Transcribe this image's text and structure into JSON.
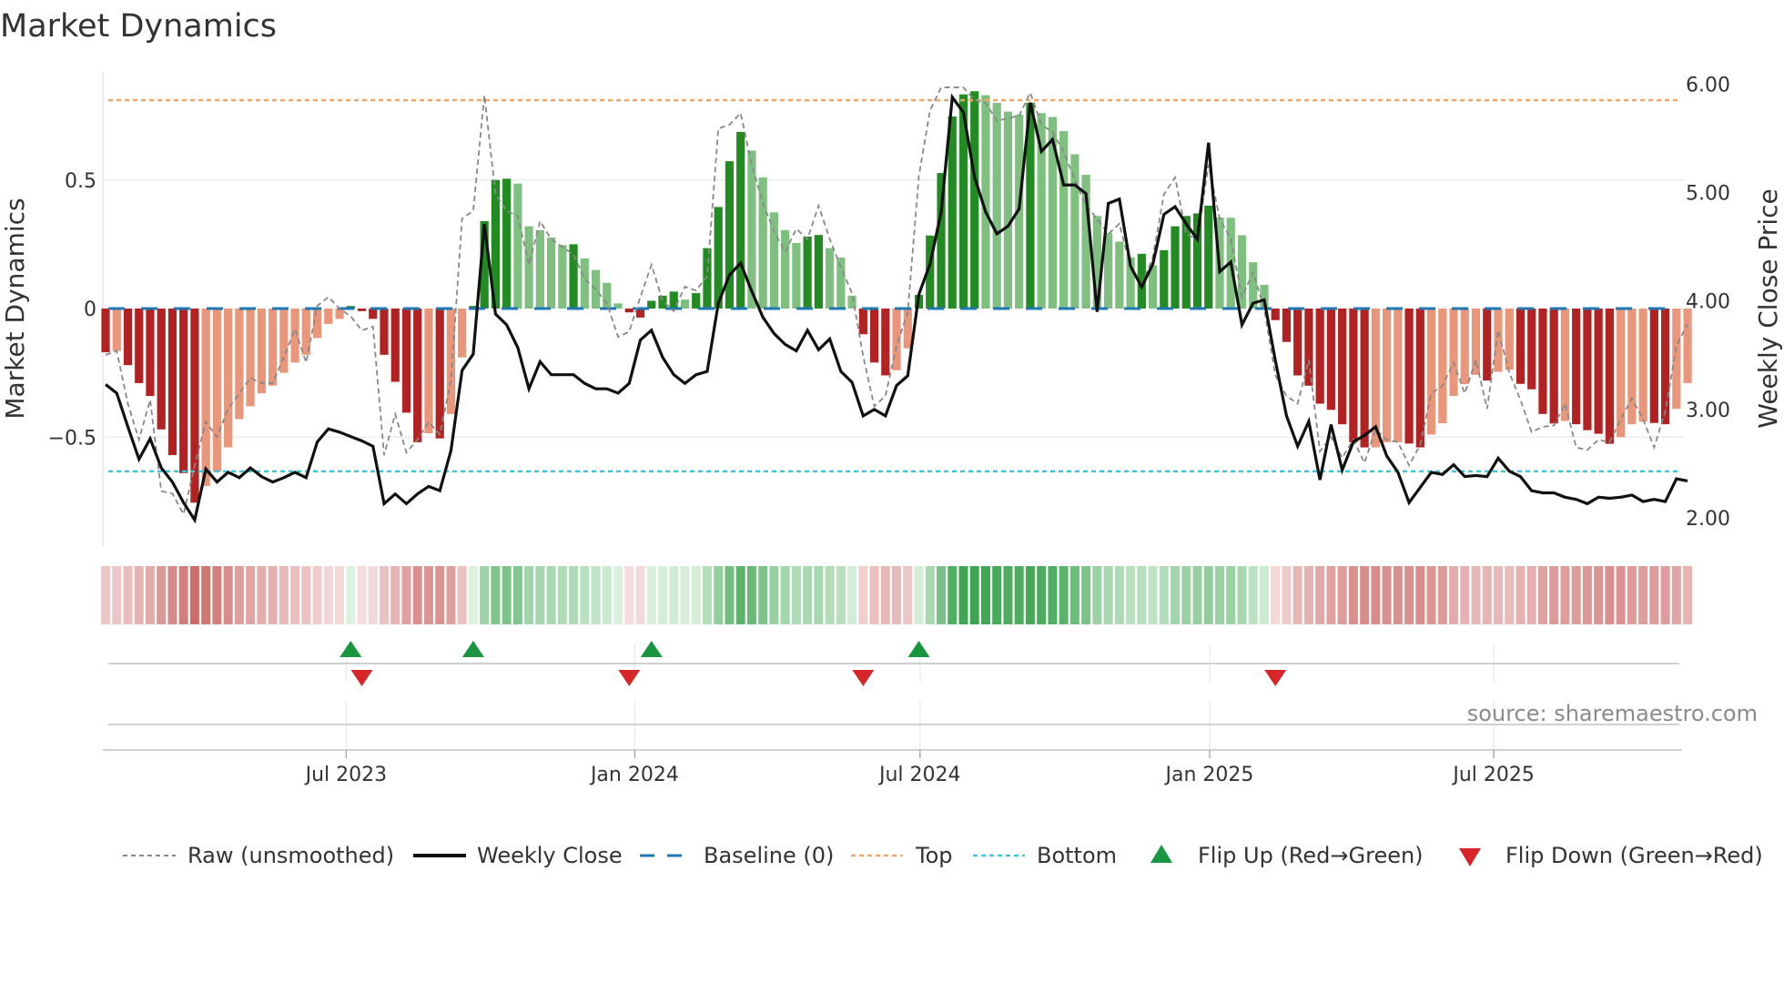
{
  "chart_data": {
    "type": "bar",
    "title": "Market Dynamics",
    "ylabel": "Market Dynamics",
    "ylabel_right": "Weekly Close Price",
    "ylim": [
      -0.925,
      0.925
    ],
    "ylim_right": [
      1.74,
      6.126
    ],
    "yticks": [
      {
        "value": 0.5,
        "label": "0.5"
      },
      {
        "value": 0,
        "label": "0"
      },
      {
        "value": -0.5,
        "label": "−0.5"
      }
    ],
    "yticks_right": [
      {
        "value": 6,
        "label": "6.00"
      },
      {
        "value": 5,
        "label": "5.00"
      },
      {
        "value": 4,
        "label": "4.00"
      },
      {
        "value": 3,
        "label": "3.00"
      },
      {
        "value": 2,
        "label": "2.00"
      }
    ],
    "x_unit": "week index (1 = first weekly bar, approx. late Jan 2023)",
    "xticks": [
      {
        "week": 22.6,
        "label": "Jul 2023"
      },
      {
        "week": 48.5,
        "label": "Jan 2024"
      },
      {
        "week": 74.1,
        "label": "Jul 2024"
      },
      {
        "week": 100.1,
        "label": "Jan 2025"
      },
      {
        "week": 125.6,
        "label": "Jul 2025"
      }
    ],
    "top_level": 0.81,
    "bottom_level": -0.633,
    "baseline": 0,
    "grid": true,
    "legend_placement": "bottom",
    "series": [
      {
        "name": "Market Dynamics (smoothed)",
        "kind": "bar",
        "values": [
          -0.17,
          -0.165,
          -0.22,
          -0.29,
          -0.34,
          -0.47,
          -0.57,
          -0.64,
          -0.755,
          -0.69,
          -0.635,
          -0.54,
          -0.43,
          -0.38,
          -0.33,
          -0.3,
          -0.25,
          -0.21,
          -0.18,
          -0.115,
          -0.06,
          -0.04,
          0.01,
          -0.01,
          -0.04,
          -0.18,
          -0.285,
          -0.405,
          -0.52,
          -0.485,
          -0.505,
          -0.41,
          -0.19,
          0.01,
          0.34,
          0.5,
          0.505,
          0.486,
          0.32,
          0.305,
          0.276,
          0.247,
          0.25,
          0.195,
          0.15,
          0.1,
          0.02,
          -0.015,
          -0.035,
          0.03,
          0.05,
          0.066,
          0.035,
          0.06,
          0.235,
          0.395,
          0.573,
          0.687,
          0.614,
          0.51,
          0.374,
          0.305,
          0.255,
          0.28,
          0.286,
          0.235,
          0.198,
          0.05,
          -0.1,
          -0.21,
          -0.26,
          -0.24,
          -0.155,
          0.053,
          0.284,
          0.527,
          0.747,
          0.833,
          0.845,
          0.83,
          0.8,
          0.766,
          0.754,
          0.8,
          0.76,
          0.745,
          0.69,
          0.6,
          0.52,
          0.36,
          0.294,
          0.26,
          0.2,
          0.213,
          0.168,
          0.227,
          0.32,
          0.36,
          0.37,
          0.4,
          0.354,
          0.353,
          0.285,
          0.18,
          0.092,
          -0.045,
          -0.13,
          -0.26,
          -0.3,
          -0.37,
          -0.394,
          -0.45,
          -0.52,
          -0.54,
          -0.54,
          -0.52,
          -0.52,
          -0.525,
          -0.54,
          -0.49,
          -0.446,
          -0.34,
          -0.294,
          -0.258,
          -0.28,
          -0.246,
          -0.238,
          -0.293,
          -0.314,
          -0.41,
          -0.447,
          -0.437,
          -0.45,
          -0.473,
          -0.487,
          -0.526,
          -0.5,
          -0.45,
          -0.44,
          -0.445,
          -0.45,
          -0.39,
          -0.29
        ]
      },
      {
        "name": "Raw (unsmoothed)",
        "kind": "line",
        "values": [
          -0.18,
          -0.165,
          -0.37,
          -0.51,
          -0.355,
          -0.71,
          -0.72,
          -0.8,
          -0.61,
          -0.44,
          -0.5,
          -0.39,
          -0.33,
          -0.27,
          -0.29,
          -0.29,
          -0.19,
          -0.08,
          -0.21,
          0.01,
          0.045,
          0.0,
          -0.03,
          -0.085,
          -0.07,
          -0.57,
          -0.41,
          -0.56,
          -0.51,
          -0.44,
          -0.49,
          -0.28,
          0.35,
          0.38,
          0.83,
          0.445,
          0.38,
          0.36,
          0.17,
          0.34,
          0.27,
          0.24,
          0.21,
          0.115,
          0.075,
          0.02,
          -0.11,
          -0.09,
          0.045,
          0.17,
          0.03,
          -0.01,
          0.085,
          0.07,
          0.127,
          0.7,
          0.715,
          0.76,
          0.56,
          0.41,
          0.3,
          0.22,
          0.31,
          0.27,
          0.4,
          0.27,
          0.16,
          0.06,
          -0.185,
          -0.38,
          -0.34,
          -0.145,
          -0.015,
          0.515,
          0.77,
          0.86,
          0.86,
          0.86,
          0.81,
          0.8,
          0.73,
          0.74,
          0.75,
          0.84,
          0.715,
          0.686,
          0.61,
          0.5,
          0.4,
          0.35,
          0.29,
          0.33,
          0.16,
          0.09,
          0.2,
          0.445,
          0.51,
          0.29,
          0.27,
          0.56,
          0.35,
          0.27,
          0.045,
          0.14,
          0.0,
          -0.26,
          -0.34,
          -0.37,
          -0.2,
          -0.555,
          -0.5,
          -0.58,
          -0.51,
          -0.6,
          -0.47,
          -0.51,
          -0.52,
          -0.61,
          -0.53,
          -0.33,
          -0.3,
          -0.21,
          -0.33,
          -0.2,
          -0.39,
          -0.085,
          -0.25,
          -0.355,
          -0.48,
          -0.46,
          -0.455,
          -0.37,
          -0.54,
          -0.55,
          -0.51,
          -0.52,
          -0.43,
          -0.35,
          -0.43,
          -0.54,
          -0.4,
          -0.145,
          -0.06
        ]
      },
      {
        "name": "Weekly Close",
        "kind": "line",
        "axis": "right",
        "values": [
          3.23,
          3.15,
          2.84,
          2.54,
          2.73,
          2.46,
          2.33,
          2.14,
          1.98,
          2.45,
          2.33,
          2.42,
          2.37,
          2.46,
          2.38,
          2.33,
          2.37,
          2.42,
          2.37,
          2.7,
          2.82,
          2.79,
          2.75,
          2.71,
          2.66,
          2.13,
          2.22,
          2.13,
          2.22,
          2.29,
          2.25,
          2.62,
          3.36,
          3.51,
          4.71,
          3.88,
          3.78,
          3.57,
          3.19,
          3.44,
          3.32,
          3.32,
          3.32,
          3.24,
          3.19,
          3.19,
          3.15,
          3.24,
          3.64,
          3.73,
          3.48,
          3.32,
          3.24,
          3.32,
          3.35,
          3.98,
          4.24,
          4.35,
          4.09,
          3.85,
          3.7,
          3.6,
          3.54,
          3.73,
          3.55,
          3.65,
          3.35,
          3.25,
          2.94,
          3.0,
          2.94,
          3.22,
          3.31,
          4.06,
          4.34,
          4.82,
          5.88,
          5.74,
          5.14,
          4.82,
          4.62,
          4.69,
          4.85,
          5.83,
          5.38,
          5.49,
          5.07,
          5.07,
          4.99,
          3.9,
          4.9,
          4.94,
          4.32,
          4.13,
          4.34,
          4.8,
          4.87,
          4.71,
          4.57,
          5.46,
          4.27,
          4.36,
          3.78,
          3.98,
          4.01,
          3.45,
          2.94,
          2.66,
          2.89,
          2.35,
          2.86,
          2.44,
          2.7,
          2.76,
          2.84,
          2.57,
          2.42,
          2.14,
          2.28,
          2.42,
          2.4,
          2.49,
          2.38,
          2.39,
          2.38,
          2.55,
          2.43,
          2.38,
          2.25,
          2.23,
          2.23,
          2.19,
          2.17,
          2.13,
          2.19,
          2.18,
          2.19,
          2.21,
          2.15,
          2.17,
          2.15,
          2.36,
          2.34
        ]
      }
    ],
    "flip_up_weeks": [
      23,
      34,
      50,
      74
    ],
    "flip_down_weeks": [
      24,
      48,
      69,
      106
    ],
    "legend": [
      {
        "label": "Raw (unsmoothed)",
        "style": "dashed-grey"
      },
      {
        "label": "Weekly Close",
        "style": "solid-black"
      },
      {
        "label": "Baseline (0)",
        "style": "dashed-blue"
      },
      {
        "label": "Top",
        "style": "dotted-orange"
      },
      {
        "label": "Bottom",
        "style": "dotted-cyan"
      },
      {
        "label": "Flip Up (Red→Green)",
        "style": "triangle-up-green"
      },
      {
        "label": "Flip Down (Green→Red)",
        "style": "triangle-down-red"
      }
    ],
    "source": "source: sharemaestro.com"
  },
  "colors": {
    "dark_red": "#b22222",
    "light_red": "#e9967a",
    "dark_green": "#228b22",
    "light_green": "#7fbf7f",
    "baseline": "#1f77b4",
    "top": "#f0a868",
    "bottom": "#3cc8d8",
    "close": "#111111",
    "raw": "#888888",
    "flip_up": "#1a9641",
    "flip_down": "#d7262a"
  }
}
